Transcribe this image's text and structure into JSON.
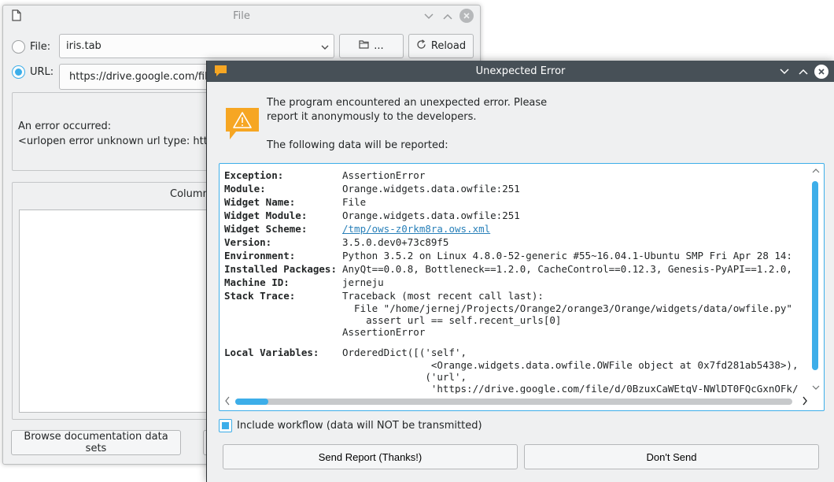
{
  "file_window": {
    "title": "File",
    "file_label": "File:",
    "file_combo_value": "iris.tab",
    "browse_label": "...",
    "reload_label": "Reload",
    "url_label": "URL:",
    "url_value": "https://drive.google.com/file",
    "info_line1": "An error occurred:",
    "info_line2": "<urlopen error unknown url type: htt>",
    "columns_title": "Column",
    "browse_docs_label": "Browse documentation data sets"
  },
  "error_dialog": {
    "title": "Unexpected Error",
    "message_line1": "The program encountered an unexpected error. Please",
    "message_line2": "report it anonymously to the developers.",
    "message_line3": "The following data will be reported:",
    "report": {
      "exception_key": "Exception:",
      "exception_val": "AssertionError",
      "module_key": "Module:",
      "module_val": "Orange.widgets.data.owfile:251",
      "widget_name_key": "Widget Name:",
      "widget_name_val": "File",
      "widget_module_key": "Widget Module:",
      "widget_module_val": "Orange.widgets.data.owfile:251",
      "widget_scheme_key": "Widget Scheme:",
      "widget_scheme_val": "/tmp/ows-z0rkm8ra.ows.xml",
      "version_key": "Version:",
      "version_val": "3.5.0.dev0+73c89f5",
      "environment_key": "Environment:",
      "environment_val": "Python 3.5.2 on Linux 4.8.0-52-generic #55~16.04.1-Ubuntu SMP Fri Apr 28 14:",
      "packages_key": "Installed Packages:",
      "packages_val": "AnyQt==0.0.8, Bottleneck==1.2.0, CacheControl==0.12.3, Genesis-PyAPI==1.2.0,",
      "machine_key": "Machine ID:",
      "machine_val": "jerneju",
      "trace_key": "Stack Trace:",
      "trace_line1": "Traceback (most recent call last):",
      "trace_line2": "  File \"/home/jernej/Projects/Orange2/orange3/Orange/widgets/data/owfile.py\"",
      "trace_line3": "    assert url == self.recent_urls[0]",
      "trace_line4": "AssertionError",
      "locals_key": "Local Variables:",
      "locals_line1": "OrderedDict([('self',",
      "locals_line2": "               <Orange.widgets.data.owfile.OWFile object at 0x7fd281ab5438>),",
      "locals_line3": "              ('url',",
      "locals_line4": "               'https://drive.google.com/file/d/0BzuxCaWEtqV-NWlDT0FQcGxnOFk/"
    },
    "include_workflow_label": "Include workflow (data will NOT be transmitted)",
    "send_label": "Send Report (Thanks!)",
    "dont_send_label": "Don't Send"
  },
  "colors": {
    "accent": "#3daee9",
    "titlebar_active": "#475057",
    "window_bg": "#eff0f1",
    "warning": "#f6a623"
  }
}
